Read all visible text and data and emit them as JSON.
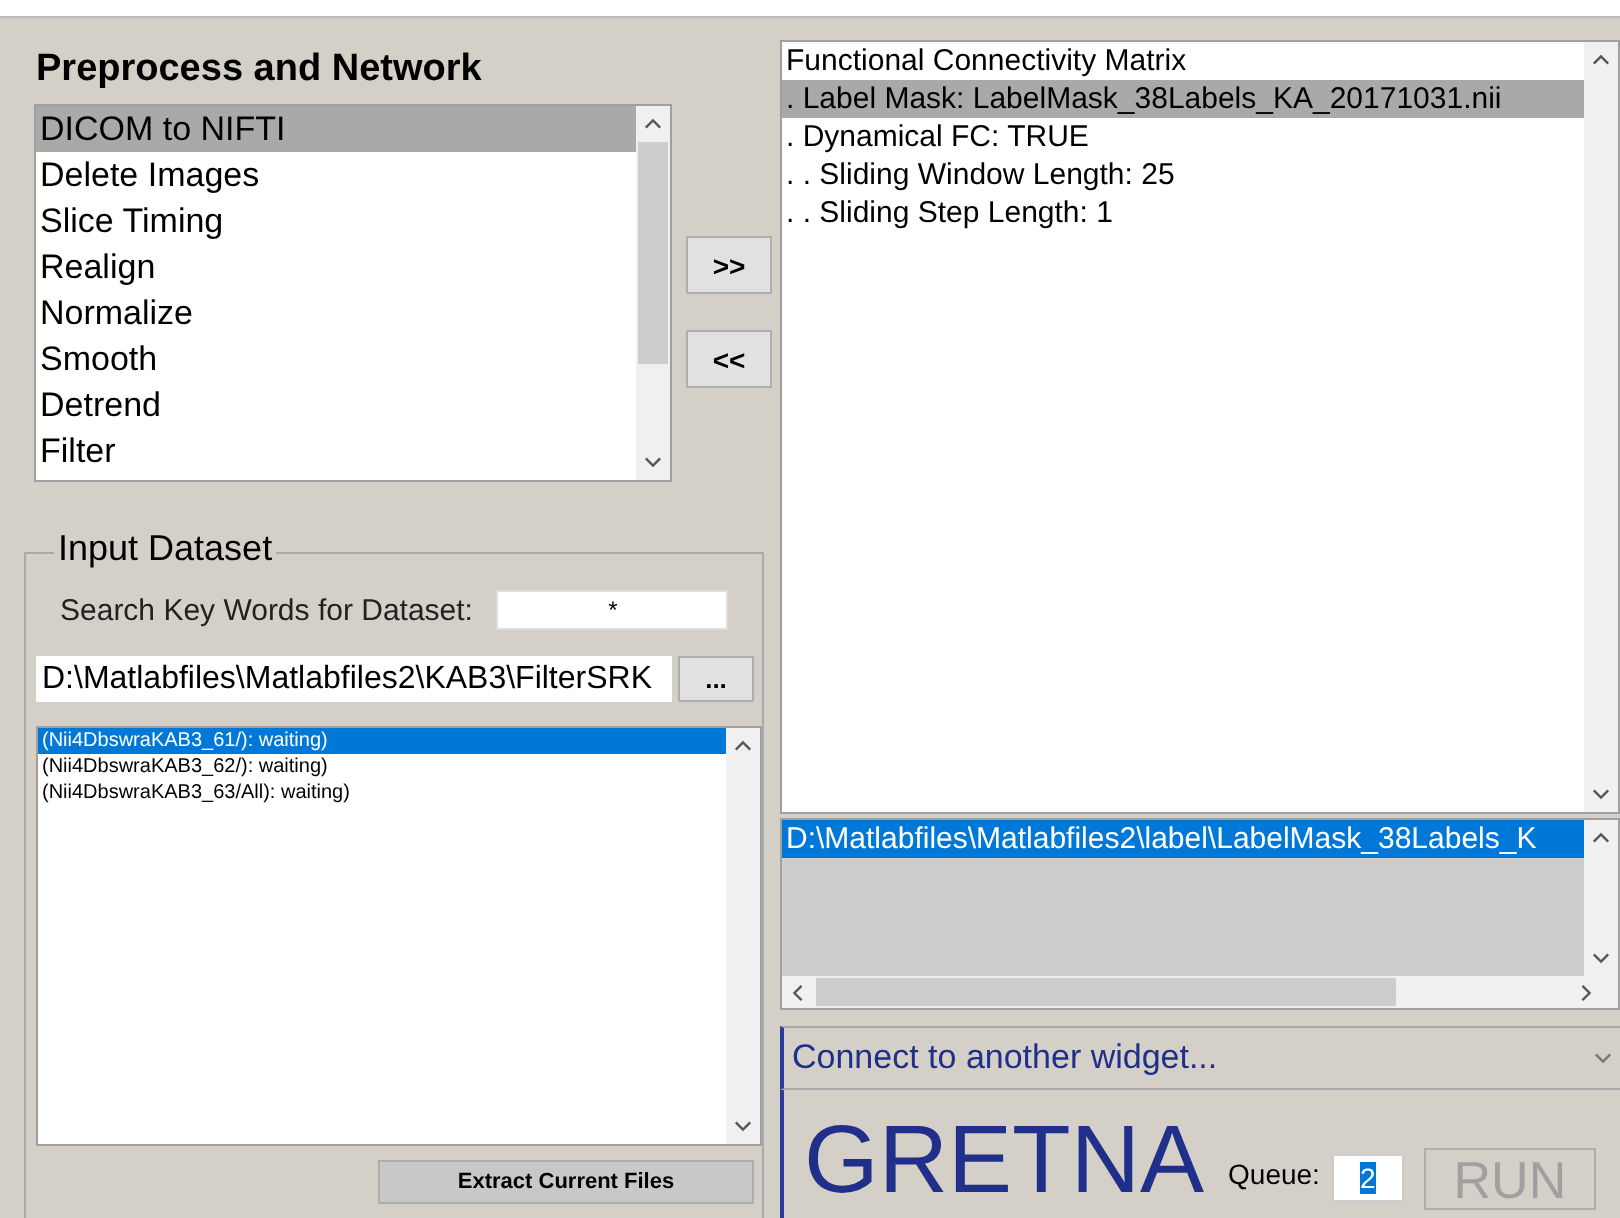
{
  "title": "Preprocess and Network",
  "modules": [
    {
      "label": "DICOM to NIFTI",
      "selected": true
    },
    {
      "label": "Delete Images",
      "selected": false
    },
    {
      "label": "Slice Timing",
      "selected": false
    },
    {
      "label": "Realign",
      "selected": false
    },
    {
      "label": "Normalize",
      "selected": false
    },
    {
      "label": "Smooth",
      "selected": false
    },
    {
      "label": "Detrend",
      "selected": false
    },
    {
      "label": "Filter",
      "selected": false
    }
  ],
  "move_buttons": [
    ">>",
    "<<"
  ],
  "input_dataset": {
    "title": "Input Dataset",
    "search_label": "Search Key Words for Dataset:",
    "search_value": "*",
    "path_value": "D:\\Matlabfiles\\Matlabfiles2\\KAB3\\FilterSRK",
    "browse_button": "...",
    "subjects": [
      {
        "label": "(Nii4DbswraKAB3_61/): waiting)",
        "selected": true
      },
      {
        "label": "(Nii4DbswraKAB3_62/): waiting)",
        "selected": false
      },
      {
        "label": "(Nii4DbswraKAB3_63/All): waiting)",
        "selected": false
      }
    ],
    "extract_button": "Extract Current Files"
  },
  "pipeline": [
    {
      "label": "Functional Connectivity Matrix",
      "selected": false
    },
    {
      "label": ". Label Mask:  LabelMask_38Labels_KA_20171031.nii",
      "selected": true
    },
    {
      "label": ". Dynamical FC:  TRUE",
      "selected": false
    },
    {
      "label": ". . Sliding Window Length:  25",
      "selected": false
    },
    {
      "label": ". . Sliding Step Length:  1",
      "selected": false
    }
  ],
  "values": [
    {
      "label": "D:\\Matlabfiles\\Matlabfiles2\\label\\LabelMask_38Labels_K",
      "selected": true
    }
  ],
  "connect": {
    "value": "Connect to another widget..."
  },
  "brand": "GRETNA",
  "queue": {
    "label": "Queue:",
    "value": "2"
  },
  "run_button": {
    "label": "RUN",
    "disabled": true
  }
}
